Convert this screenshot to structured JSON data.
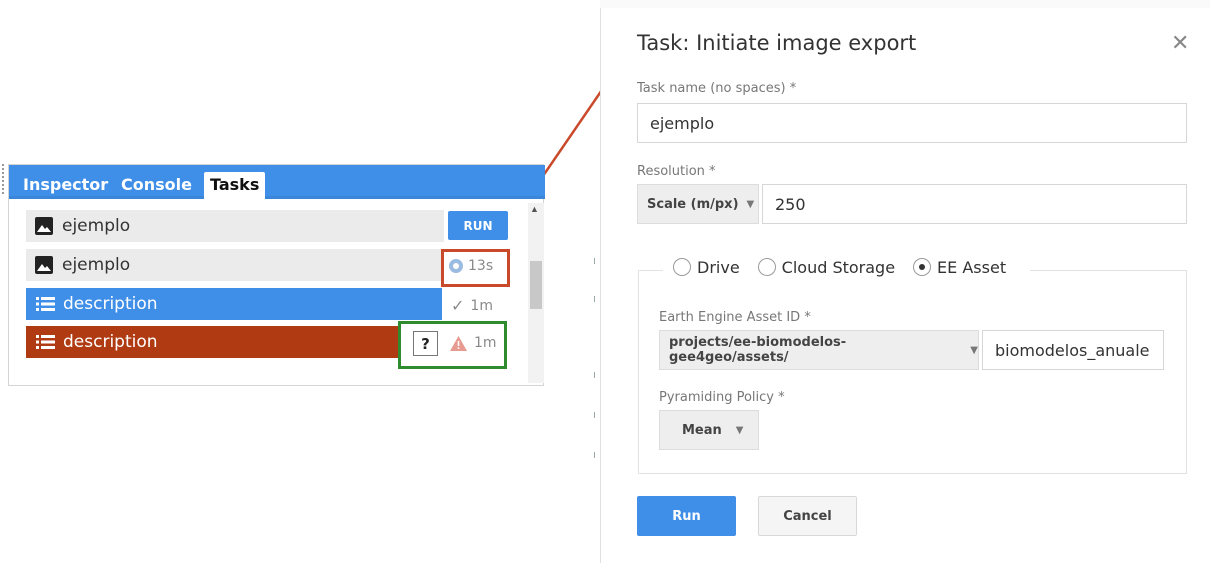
{
  "tasks_panel": {
    "tabs": [
      "Inspector",
      "Console",
      "Tasks"
    ],
    "active_tab": "Tasks",
    "rows": [
      {
        "name": "ejemplo",
        "icon": "image-icon",
        "action": "RUN"
      },
      {
        "name": "ejemplo",
        "icon": "image-icon",
        "status_icon": "gear-spinner-icon",
        "status": "13s"
      },
      {
        "name": "description",
        "icon": "list-icon",
        "state": "completed",
        "status_icon": "check-icon",
        "status": "1m"
      },
      {
        "name": "description",
        "icon": "list-icon",
        "state": "failed",
        "help": "?",
        "status_icon": "warning-icon",
        "status": "1m"
      }
    ],
    "colors": {
      "tab_bar": "#3f8fe8",
      "completed": "#3f8fe8",
      "failed": "#b03a12",
      "highlight_running": "#c94a2a",
      "highlight_failed": "#2e8b2e"
    }
  },
  "dialog": {
    "title": "Task: Initiate image export",
    "task_name_label": "Task name (no spaces) *",
    "task_name_value": "ejemplo",
    "resolution_label": "Resolution *",
    "resolution_mode": "Scale (m/px)",
    "resolution_value": "250",
    "destinations": [
      "Drive",
      "Cloud Storage",
      "EE Asset"
    ],
    "selected_destination": "EE Asset",
    "asset_id_label": "Earth Engine Asset ID *",
    "asset_root": "projects/ee-biomodelos-gee4geo/assets/",
    "asset_name": "biomodelos_anuale",
    "pyramiding_label": "Pyramiding Policy *",
    "pyramiding_value": "Mean",
    "run_label": "Run",
    "cancel_label": "Cancel"
  }
}
